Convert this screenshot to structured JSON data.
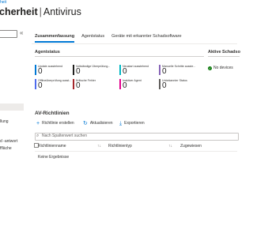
{
  "breadcrumb": "heit",
  "header": {
    "title": "cherheit",
    "separator": "|",
    "subtitle": "Antivirus"
  },
  "left_nav": {
    "items": [
      {
        "label": "llung"
      },
      {
        "label": "d -antwort"
      },
      {
        "label": "ffläche"
      }
    ]
  },
  "tabs": [
    {
      "label": "Zusammenfassung",
      "active": true
    },
    {
      "label": "Agentstatus",
      "active": false
    },
    {
      "label": "Geräte mit erkannter Schadsoftware",
      "active": false
    }
  ],
  "agent_status": {
    "title": "Agentstatus",
    "tiles": [
      {
        "label": "Update ausstehend",
        "value": "0",
        "color": "#0078d4"
      },
      {
        "label": "Vollständige Überprüfung...",
        "value": "0",
        "color": "#201f1e"
      },
      {
        "label": "Neustart ausstehend",
        "value": "0",
        "color": "#00b7c3"
      },
      {
        "label": "Manuelle Schritte ausste...",
        "value": "0",
        "color": "#8764b8"
      },
      {
        "label": "Offlineüberprüfung ausst...",
        "value": "0",
        "color": "#4f6bed"
      },
      {
        "label": "Kritische Fehler",
        "value": "0",
        "color": "#a4262c"
      },
      {
        "label": "Inaktiver Agent",
        "value": "0",
        "color": "#e3008c"
      },
      {
        "label": "Unbekannter Status",
        "value": "0",
        "color": "#605e5c"
      }
    ]
  },
  "active_threats": {
    "title": "Aktive Schadso",
    "status_text": "No devices"
  },
  "av_policies": {
    "title": "AV-Richtlinien",
    "commands": [
      {
        "label": "Richtlinie erstellen",
        "icon": "plus-icon"
      },
      {
        "label": "Aktualisieren",
        "icon": "refresh-icon"
      },
      {
        "label": "Exportieren",
        "icon": "download-icon"
      }
    ],
    "filter_placeholder": "Nach Spaltenwert suchen",
    "columns": [
      "Richtlinienname",
      "Richtlinientyp",
      "Zugewiesen"
    ],
    "empty_text": "Keine Ergebnisse"
  }
}
